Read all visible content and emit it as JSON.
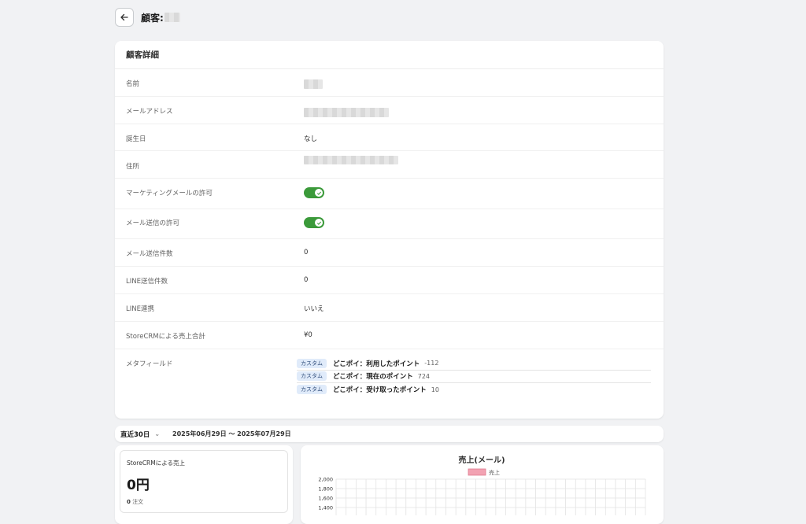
{
  "header": {
    "title": "顧客:"
  },
  "details": {
    "title": "顧客詳細",
    "rows": {
      "name": {
        "label": "名前"
      },
      "email": {
        "label": "メールアドレス"
      },
      "birthday": {
        "label": "誕生日",
        "value": "なし"
      },
      "address": {
        "label": "住所"
      },
      "marketing": {
        "label": "マーケティングメールの許可",
        "on": true
      },
      "mail_send": {
        "label": "メール送信の許可",
        "on": true
      },
      "mail_count": {
        "label": "メール送信件数",
        "value": "0"
      },
      "line_count": {
        "label": "LINE送信件数",
        "value": "0"
      },
      "line_link": {
        "label": "LINE連携",
        "value": "いいえ"
      },
      "sales_total": {
        "label": "StoreCRMによる売上合計",
        "value": "¥0"
      },
      "metafields": {
        "label": "メタフィールド",
        "items": [
          {
            "tag": "カスタム",
            "name": "どこポイ：利用したポイント",
            "value": "-112"
          },
          {
            "tag": "カスタム",
            "name": "どこポイ：現在のポイント",
            "value": "724"
          },
          {
            "tag": "カスタム",
            "name": "どこポイ：受け取ったポイント",
            "value": "10"
          }
        ]
      }
    }
  },
  "filter": {
    "range": "直近30日",
    "dates": "2025年06月29日 〜 2025年07月29日"
  },
  "sales_card": {
    "title": "StoreCRMによる売上",
    "amount": "0円",
    "orders_count": "0",
    "orders_label": "注文"
  },
  "chart_data": {
    "type": "bar",
    "title": "売上(メール)",
    "series": [
      {
        "name": "売上",
        "values": [],
        "color": "#f2a2b2"
      }
    ],
    "yticks": [
      "2,000",
      "1,800",
      "1,600",
      "1,400"
    ],
    "ylim": [
      0,
      2000
    ],
    "grid": true,
    "legend": "top"
  }
}
